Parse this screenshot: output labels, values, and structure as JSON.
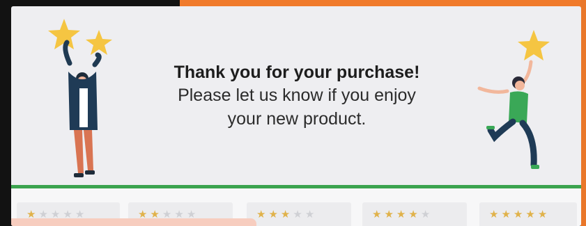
{
  "message": {
    "title": "Thank you for your purchase!",
    "line1": "Please let us know if you enjoy",
    "line2": "your new product."
  },
  "rating_options": [
    {
      "stars": 1,
      "max": 5
    },
    {
      "stars": 2,
      "max": 5
    },
    {
      "stars": 3,
      "max": 5
    },
    {
      "stars": 4,
      "max": 5
    },
    {
      "stars": 5,
      "max": 5
    }
  ],
  "colors": {
    "star_active": "#e0b24a",
    "star_inactive": "#cfd0d4",
    "divider": "#3ba34f",
    "frame_accent": "#f07a2b",
    "illustration_star": "#f5c542"
  },
  "icons": [
    "star-icon",
    "person-holding-stars-illustration",
    "person-jumping-with-star-illustration"
  ]
}
